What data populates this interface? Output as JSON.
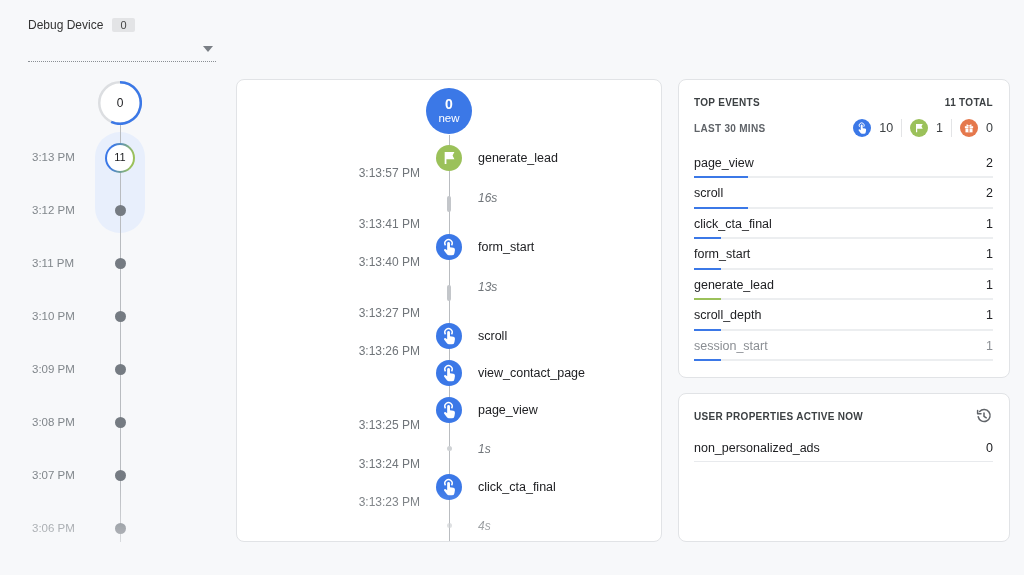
{
  "device": {
    "label": "Debug Device",
    "count": "0"
  },
  "countdown": {
    "count": "0"
  },
  "minutes": [
    {
      "time": "3:13 PM",
      "count": "11",
      "selected": true
    },
    {
      "time": "3:12 PM",
      "selected": false
    },
    {
      "time": "3:11 PM",
      "selected": false
    },
    {
      "time": "3:10 PM",
      "selected": false
    },
    {
      "time": "3:09 PM",
      "selected": false
    },
    {
      "time": "3:08 PM",
      "selected": false
    },
    {
      "time": "3:07 PM",
      "selected": false
    },
    {
      "time": "3:06 PM",
      "selected": false
    }
  ],
  "stream": {
    "new_count": "0",
    "new_label": "new",
    "entries": [
      {
        "kind": "flag",
        "name": "generate_lead",
        "time": "3:13:57 PM"
      },
      {
        "kind": "bar",
        "duration": "16s",
        "time": "3:13:41 PM"
      },
      {
        "kind": "tap",
        "name": "form_start",
        "time": "3:13:40 PM"
      },
      {
        "kind": "bar",
        "duration": "13s",
        "time": "3:13:27 PM"
      },
      {
        "kind": "tap",
        "name": "scroll",
        "time": "3:13:26 PM"
      },
      {
        "kind": "tap",
        "name": "view_contact_page"
      },
      {
        "kind": "tap",
        "name": "page_view",
        "time": "3:13:25 PM"
      },
      {
        "kind": "dot",
        "duration": "1s",
        "time": "3:13:24 PM"
      },
      {
        "kind": "tap",
        "name": "click_cta_final",
        "time": "3:13:23 PM"
      },
      {
        "kind": "dot",
        "duration": "4s"
      }
    ]
  },
  "top_events": {
    "title": "TOP EVENTS",
    "total": "11 TOTAL",
    "period": "LAST 30 MINS",
    "legend": [
      {
        "kind": "tap",
        "count": "10"
      },
      {
        "kind": "flag",
        "count": "1"
      },
      {
        "kind": "gift",
        "count": "0"
      }
    ],
    "rows": [
      {
        "name": "page_view",
        "count": "2",
        "level": 0.18,
        "color": "#3b78e7"
      },
      {
        "name": "scroll",
        "count": "2",
        "level": 0.18,
        "color": "#3b78e7"
      },
      {
        "name": "click_cta_final",
        "count": "1",
        "level": 0.09,
        "color": "#3b78e7"
      },
      {
        "name": "form_start",
        "count": "1",
        "level": 0.09,
        "color": "#3b78e7"
      },
      {
        "name": "generate_lead",
        "count": "1",
        "level": 0.09,
        "color": "#9bc15a"
      },
      {
        "name": "scroll_depth",
        "count": "1",
        "level": 0.09,
        "color": "#3b78e7"
      },
      {
        "name": "session_start",
        "count": "1",
        "level": 0.09,
        "color": "#3b78e7"
      }
    ]
  },
  "user_properties": {
    "title": "USER PROPERTIES ACTIVE NOW",
    "rows": [
      {
        "name": "non_personalized_ads",
        "value": "0"
      }
    ]
  }
}
